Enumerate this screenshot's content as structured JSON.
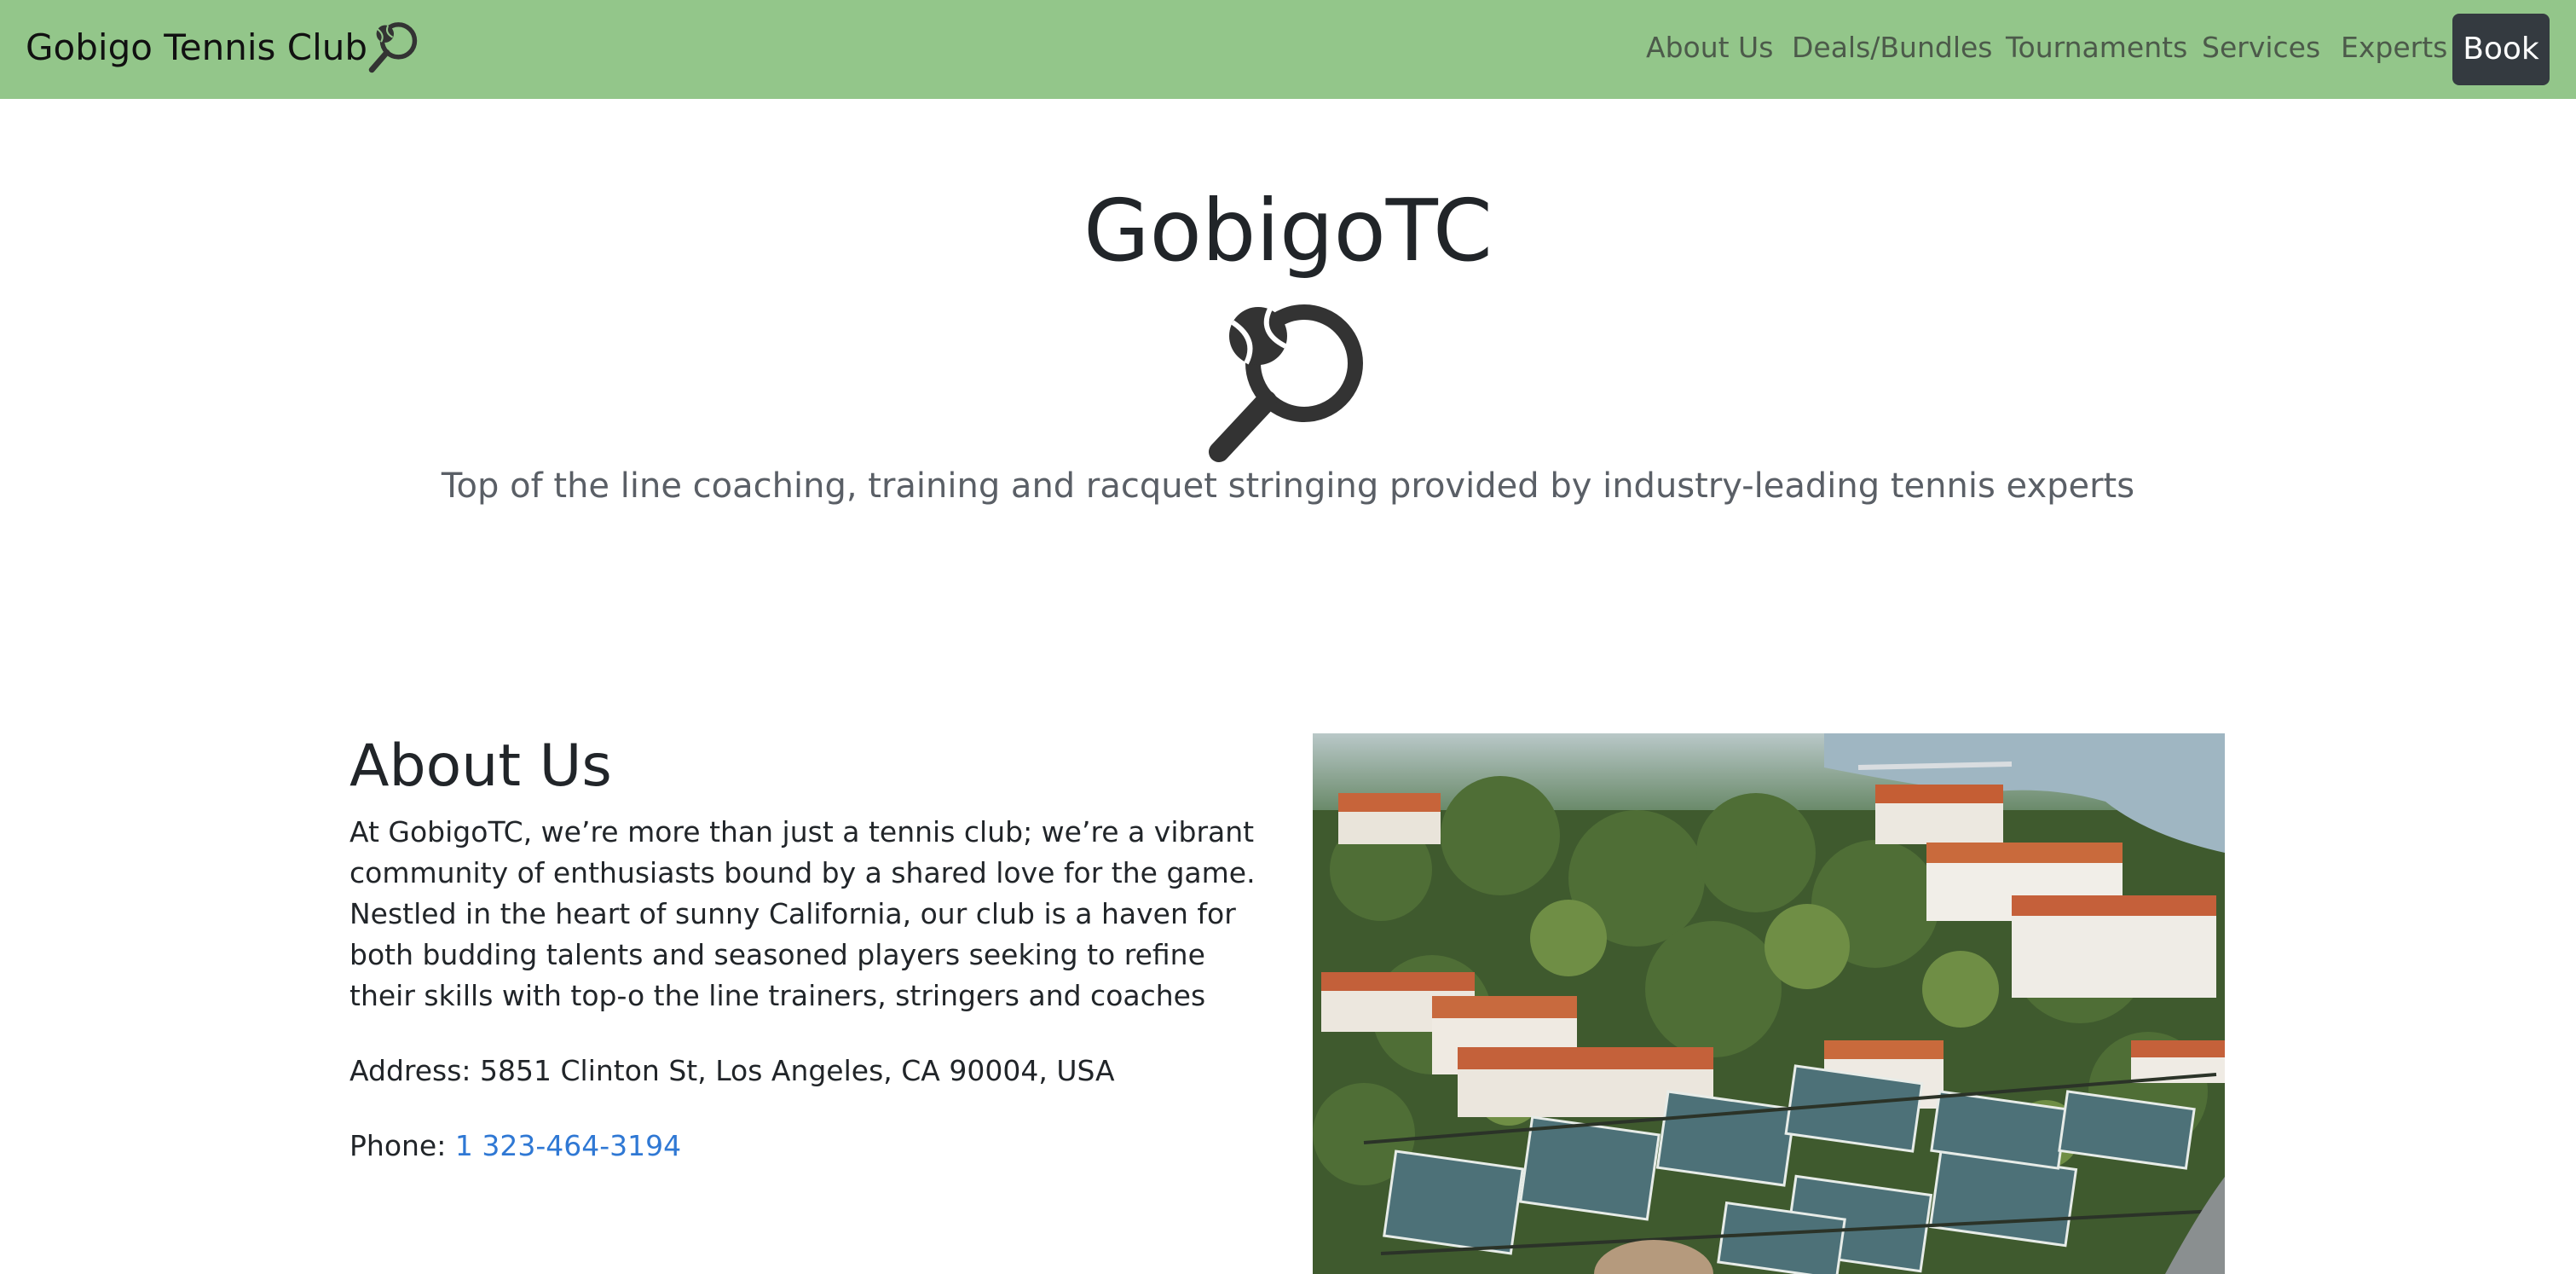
{
  "navbar": {
    "brand": "Gobigo Tennis Club",
    "brand_icon": "tennis-racquet-ball-icon",
    "links": [
      "About Us",
      "Deals/Bundles",
      "Tournaments",
      "Services",
      "Experts"
    ],
    "book_label": "Book",
    "background": "#93c68a"
  },
  "hero": {
    "title": "GobigoTC",
    "icon": "tennis-racquet-ball-icon",
    "subtitle": "Top of the line coaching, training and racquet stringing provided by industry-leading tennis experts"
  },
  "about": {
    "title": "About Us",
    "text": "At GobigoTC, we’re more than just a tennis club; we’re a vibrant community of enthusiasts bound by a shared love for the game. Nestled in the heart of sunny California, our club is a haven for both budding talents and seasoned players seeking to refine their skills with top-o the line trainers, stringers and coaches",
    "address": "Address: 5851 Clinton St, Los Angeles, CA 90004, USA",
    "phone_label": "Phone: ",
    "phone_number": "1 323-464-3194",
    "photo": "aerial-tennis-club-photo"
  },
  "colors": {
    "link": "#2f78d4",
    "book_button": "#343a40"
  }
}
